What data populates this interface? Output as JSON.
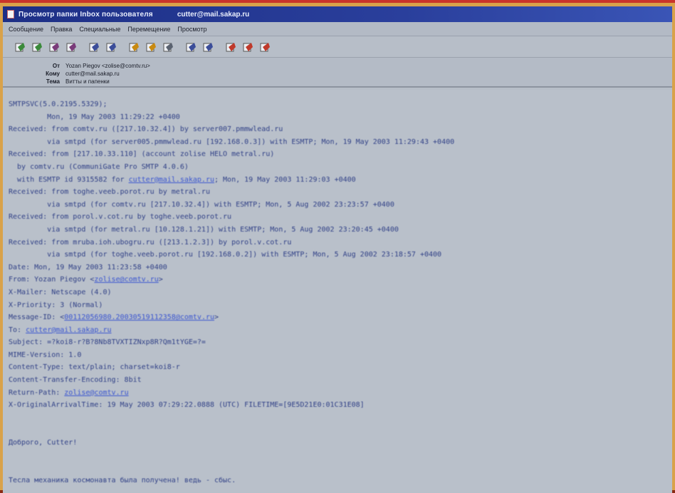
{
  "window": {
    "title": "Просмотр папки Inbox пользователя",
    "account": "cutter@mail.sakap.ru"
  },
  "menu": [
    "Сообщение",
    "Правка",
    "Специальные",
    "Перемещение",
    "Просмотр"
  ],
  "toolbar": [
    {
      "icon": "reply-icon",
      "color": "#3a8a3a"
    },
    {
      "icon": "reply-all-icon",
      "color": "#3a8a3a"
    },
    {
      "icon": "forward-icon",
      "color": "#7a3b7a"
    },
    {
      "icon": "redirect-icon",
      "color": "#7a3b7a"
    },
    {
      "icon": "save-icon",
      "color": "#3b4d9a"
    },
    {
      "icon": "print-icon",
      "color": "#3b4d9a"
    },
    {
      "icon": "find-icon",
      "color": "#c98a10"
    },
    {
      "icon": "mark-icon",
      "color": "#c98a10"
    },
    {
      "icon": "delete-icon",
      "color": "#5a6270"
    },
    {
      "icon": "prev-message-icon",
      "color": "#3b4d9a"
    },
    {
      "icon": "next-message-icon",
      "color": "#3b4d9a"
    },
    {
      "icon": "move-icon",
      "color": "#c0392b"
    },
    {
      "icon": "copy-icon",
      "color": "#c0392b"
    },
    {
      "icon": "close-message-icon",
      "color": "#c0392b"
    }
  ],
  "headers": [
    {
      "label": "От",
      "value": "Yozan Piegov <zolise@comtv.ru>"
    },
    {
      "label": "Кому",
      "value": "cutter@mail.sakap.ru"
    },
    {
      "label": "Тема",
      "value": "Витты и папенки"
    }
  ],
  "body": {
    "lines": [
      {
        "text": "SMTPSVC(5.0.2195.5329);"
      },
      {
        "text": "         Mon, 19 May 2003 11:29:22 +0400"
      },
      {
        "text": "Received: from comtv.ru ([217.10.32.4]) by server007.pmmwlead.ru"
      },
      {
        "text": "         via smtpd (for server005.pmmwlead.ru [192.168.0.3]) with ESMTP; Mon, 19 May 2003 11:29:43 +0400"
      },
      {
        "text": "Received: from [217.10.33.110] (account zolise HELO metral.ru)"
      },
      {
        "text": "  by comtv.ru (CommuniGate Pro SMTP 4.0.6)"
      },
      {
        "text": "  with ESMTP id 9315582 for ",
        "link": "cutter@mail.sakap.ru",
        "after": "; Mon, 19 May 2003 11:29:03 +0400"
      },
      {
        "text": "Received: from toghe.veeb.porot.ru by metral.ru"
      },
      {
        "text": "         via smtpd (for comtv.ru [217.10.32.4]) with ESMTP; Mon, 5 Aug 2002 23:23:57 +0400"
      },
      {
        "text": "Received: from porol.v.cot.ru by toghe.veeb.porot.ru"
      },
      {
        "text": "         via smtpd (for metral.ru [10.128.1.21]) with ESMTP; Mon, 5 Aug 2002 23:20:45 +0400"
      },
      {
        "text": "Received: from mruba.ioh.ubogru.ru ([213.1.2.3]) by porol.v.cot.ru"
      },
      {
        "text": "         via smtpd (for toghe.veeb.porot.ru [192.168.0.2]) with ESMTP; Mon, 5 Aug 2002 23:18:57 +0400"
      },
      {
        "text": "Date: Mon, 19 May 2003 11:23:58 +0400"
      },
      {
        "text": "From: Yozan Piegov <",
        "link": "zolise@comtv.ru",
        "after": ">"
      },
      {
        "text": "X-Mailer: Netscape (4.0)"
      },
      {
        "text": "X-Priority: 3 (Normal)"
      },
      {
        "text": "Message-ID: <",
        "link": "00112056980.20030519112358@comtv.ru",
        "after": ">"
      },
      {
        "text": "To: ",
        "link": "cutter@mail.sakap.ru",
        "after": ""
      },
      {
        "text": "Subject: =?koi8-r?B?8Nb8TVXTIZNxp8R?Qm1tYGE=?="
      },
      {
        "text": "MIME-Version: 1.0"
      },
      {
        "text": "Content-Type: text/plain; charset=koi8-r"
      },
      {
        "text": "Content-Transfer-Encoding: 8bit"
      },
      {
        "text": "Return-Path: ",
        "link": "zolise@comtv.ru",
        "after": ""
      },
      {
        "text": "X-OriginalArrivalTime: 19 May 2003 07:29:22.0888 (UTC) FILETIME=[9E5D21E0:01C31E08]"
      },
      {
        "text": ""
      },
      {
        "text": ""
      },
      {
        "text": "Доброго, Cutter!"
      },
      {
        "text": ""
      },
      {
        "text": ""
      },
      {
        "text": "Тесла механика космонавта была получена! ведь - сбыс."
      }
    ]
  }
}
